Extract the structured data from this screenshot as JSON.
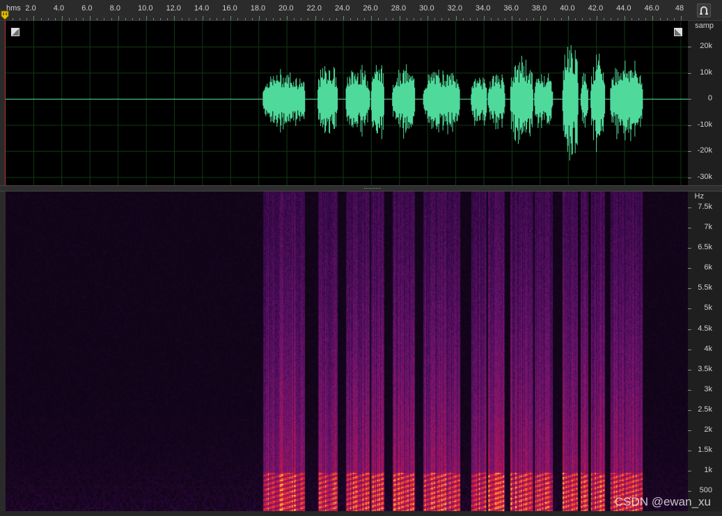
{
  "timeline": {
    "unit_label": "hms",
    "tick_labels": [
      "2.0",
      "4.0",
      "6.0",
      "8.0",
      "10.0",
      "12.0",
      "14.0",
      "16.0",
      "18.0",
      "20.0",
      "22.0",
      "24.0",
      "26.0",
      "28.0",
      "30.0",
      "32.0",
      "34.0",
      "36.0",
      "38.0",
      "40.0",
      "42.0",
      "44.0",
      "46.0",
      "48"
    ],
    "tick_values": [
      2,
      4,
      6,
      8,
      10,
      12,
      14,
      16,
      18,
      20,
      22,
      24,
      26,
      28,
      30,
      32,
      34,
      36,
      38,
      40,
      42,
      44,
      46,
      48
    ]
  },
  "waveform": {
    "unit_label": "samp",
    "scale_labels": [
      "20k",
      "10k",
      "0",
      "-10k",
      "-20k",
      "-30k"
    ],
    "scale_values": [
      20000,
      10000,
      0,
      -10000,
      -20000,
      -30000
    ],
    "y_range": [
      -33000,
      30000
    ],
    "wave_color": "#4fd99a",
    "segments": [
      {
        "start": 18.3,
        "end": 21.3,
        "amp": 11000
      },
      {
        "start": 22.2,
        "end": 23.6,
        "amp": 14000
      },
      {
        "start": 24.2,
        "end": 25.9,
        "amp": 13000
      },
      {
        "start": 26.0,
        "end": 26.9,
        "amp": 15000
      },
      {
        "start": 27.5,
        "end": 29.1,
        "amp": 13000
      },
      {
        "start": 29.7,
        "end": 32.3,
        "amp": 12000
      },
      {
        "start": 33.1,
        "end": 34.2,
        "amp": 10000
      },
      {
        "start": 34.3,
        "end": 35.5,
        "amp": 11000
      },
      {
        "start": 35.9,
        "end": 37.5,
        "amp": 16000
      },
      {
        "start": 37.6,
        "end": 38.9,
        "amp": 11000
      },
      {
        "start": 39.6,
        "end": 40.7,
        "amp": 22000
      },
      {
        "start": 40.9,
        "end": 41.4,
        "amp": 12000
      },
      {
        "start": 41.6,
        "end": 42.6,
        "amp": 17000
      },
      {
        "start": 43.0,
        "end": 45.3,
        "amp": 15000
      }
    ]
  },
  "spectrogram": {
    "unit_label": "Hz",
    "scale_labels": [
      "7.5k",
      "7k",
      "6.5k",
      "6k",
      "5.5k",
      "5k",
      "4.5k",
      "4k",
      "3.5k",
      "3k",
      "2.5k",
      "2k",
      "1.5k",
      "1k",
      "500"
    ],
    "scale_values": [
      7500,
      7000,
      6500,
      6000,
      5500,
      5000,
      4500,
      4000,
      3500,
      3000,
      2500,
      2000,
      1500,
      1000,
      500
    ],
    "y_range": [
      0,
      7900
    ]
  },
  "x_range": [
    0,
    48.5
  ],
  "watermark": "CSDN @ewan_xu",
  "icons": {
    "playhead": "playhead-marker-icon",
    "lock": "lock-icon",
    "corner_left": "corner-expand-icon",
    "corner_right": "corner-expand-icon"
  }
}
